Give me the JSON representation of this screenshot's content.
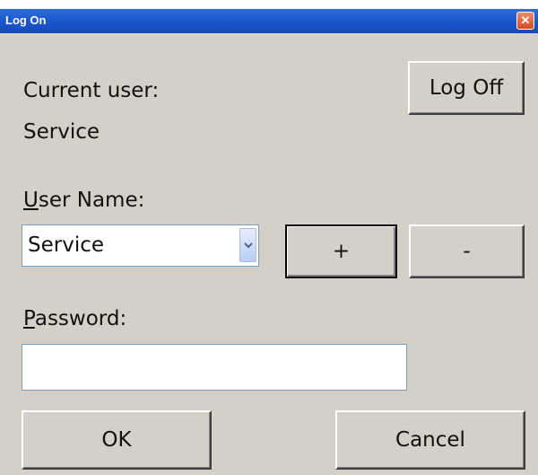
{
  "window": {
    "title": "Log On",
    "close_glyph": "✕"
  },
  "current_user": {
    "label_text": "Current user:",
    "value": "Service"
  },
  "buttons": {
    "log_off": "Log Off",
    "add": "+",
    "remove": "-",
    "ok": "OK",
    "cancel": "Cancel"
  },
  "user_name": {
    "label_first": "U",
    "label_rest": "ser Name:",
    "selected": "Service"
  },
  "password": {
    "label_first": "P",
    "label_rest": "assword:",
    "value": ""
  },
  "colors": {
    "titlebar": "#1c5ad0",
    "dialog_bg": "#d4d0c8",
    "close_button": "#d44b22"
  },
  "icons": {
    "close": "close-icon",
    "dropdown": "chevron-down-icon"
  }
}
